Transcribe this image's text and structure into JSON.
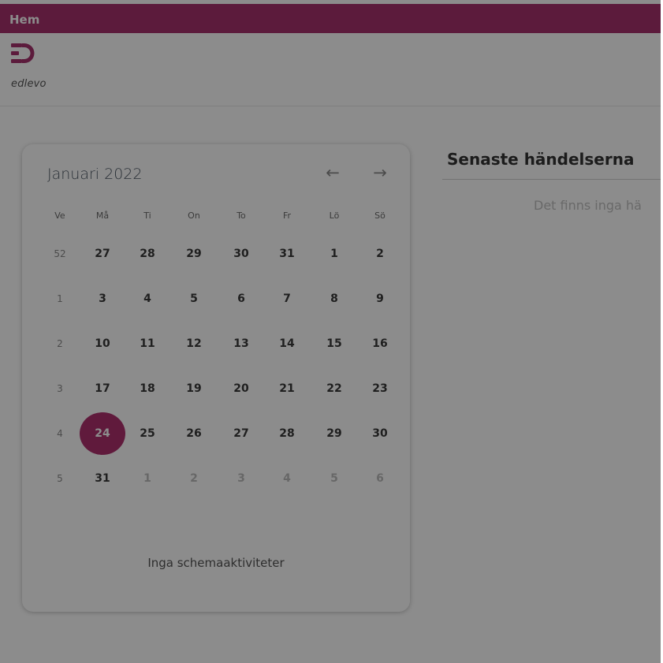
{
  "topbar": {
    "title": "Hem"
  },
  "logo": {
    "brand": "edlevo",
    "color": "#a8326e"
  },
  "calendar": {
    "month_title": "Januari 2022",
    "prev_icon": "arrow-left-icon",
    "next_icon": "arrow-right-icon",
    "prev_glyph": "←",
    "next_glyph": "→",
    "headers": [
      "Ve",
      "Må",
      "Ti",
      "On",
      "To",
      "Fr",
      "Lö",
      "Sö"
    ],
    "weeks": [
      {
        "week": "52",
        "days": [
          "27",
          "28",
          "29",
          "30",
          "31",
          "1",
          "2"
        ],
        "other": [
          false,
          false,
          false,
          false,
          false,
          false,
          false
        ]
      },
      {
        "week": "1",
        "days": [
          "3",
          "4",
          "5",
          "6",
          "7",
          "8",
          "9"
        ],
        "other": [
          false,
          false,
          false,
          false,
          false,
          false,
          false
        ]
      },
      {
        "week": "2",
        "days": [
          "10",
          "11",
          "12",
          "13",
          "14",
          "15",
          "16"
        ],
        "other": [
          false,
          false,
          false,
          false,
          false,
          false,
          false
        ]
      },
      {
        "week": "3",
        "days": [
          "17",
          "18",
          "19",
          "20",
          "21",
          "22",
          "23"
        ],
        "other": [
          false,
          false,
          false,
          false,
          false,
          false,
          false
        ]
      },
      {
        "week": "4",
        "days": [
          "24",
          "25",
          "26",
          "27",
          "28",
          "29",
          "30"
        ],
        "other": [
          false,
          false,
          false,
          false,
          false,
          false,
          false
        ]
      },
      {
        "week": "5",
        "days": [
          "31",
          "1",
          "2",
          "3",
          "4",
          "5",
          "6"
        ],
        "other": [
          false,
          true,
          true,
          true,
          true,
          true,
          true
        ]
      }
    ],
    "selected": {
      "week_index": 4,
      "day_index": 0
    },
    "selected_color": "#b0306e",
    "empty_message": "Inga schemaaktiviteter"
  },
  "events": {
    "title": "Senaste händelserna",
    "empty_message": "Det finns inga hä"
  }
}
